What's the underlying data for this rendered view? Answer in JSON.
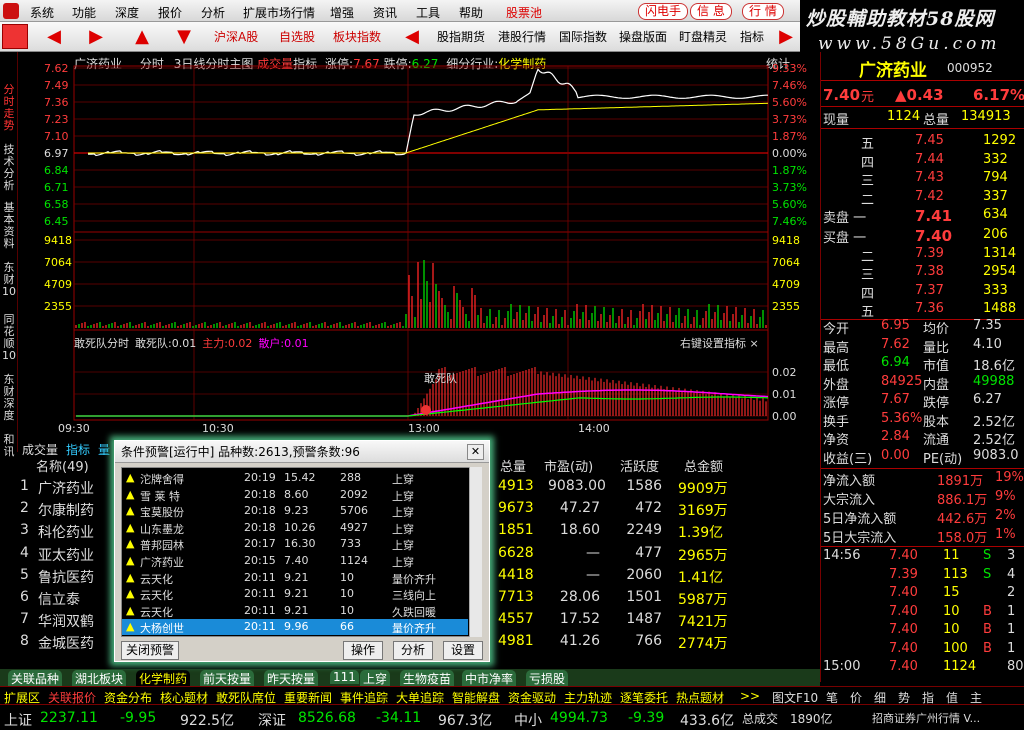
{
  "menu": {
    "items": [
      "系统",
      "功能",
      "深度",
      "报价",
      "分析",
      "扩展市场行情",
      "增强",
      "资讯",
      "工具",
      "帮助",
      "股票池"
    ],
    "pills": [
      "闪电手",
      "信 息",
      "行 情"
    ]
  },
  "brand": {
    "line1": "炒股輔助教材58股网",
    "line2": "www.58Gu.com"
  },
  "toolbar": {
    "buttons": [
      "沪深A股",
      "自选股",
      "板块指数",
      "股指期货",
      "港股行情",
      "国际指数",
      "操盘版面",
      "盯盘精灵",
      "指标"
    ]
  },
  "vtabs": [
    "分时走势",
    "技术分析",
    "基本资料",
    "东财10",
    "同花顺10",
    "东财深度",
    "和讯"
  ],
  "chart": {
    "info": {
      "name": "广济药业",
      "mode": "分时",
      "days": "3日线分时主图",
      "vol_label": "成交量",
      "ind": "指标",
      "zt_label": "涨停:",
      "zt": "7.67",
      "dt_label": "跌停:",
      "dt": "6.27",
      "industry": "细分行业:",
      "industry_val": "化学制药"
    },
    "top_right": "统计",
    "price_ticks": [
      "7.62",
      "7.49",
      "7.36",
      "7.23",
      "7.10",
      "6.97",
      "6.84",
      "6.71",
      "6.58",
      "6.45"
    ],
    "pct_ticks": [
      "9.33%",
      "7.46%",
      "5.60%",
      "3.73%",
      "1.87%",
      "0.00%",
      "1.87%",
      "3.73%",
      "5.60%",
      "7.46%"
    ],
    "vol_ticks": [
      "9418",
      "7064",
      "4709",
      "2355"
    ],
    "vol_ticks_right": [
      "9418",
      "7064",
      "4709",
      "2355"
    ],
    "ind_title": {
      "name": "敢死队分时",
      "name2": "敢死队:",
      "v1": "0.01",
      "zl": "主力:",
      "v2": "0.02",
      "sh": "散户:",
      "v3": "0.01"
    },
    "ind_right": "右键设置指标 ×",
    "ind_ticks": [
      "0.02",
      "0.01",
      "0.00"
    ],
    "ind_annot": "敢死队",
    "times": [
      "09:30",
      "10:30",
      "13:00",
      "14:00"
    ]
  },
  "chart_data": {
    "type": "line",
    "x": [
      "09:30",
      "10:30",
      "13:00",
      "14:00"
    ],
    "ylim": [
      6.45,
      7.62
    ]
  },
  "bottomtabs": [
    "成交量",
    "指标",
    "量"
  ],
  "quote": {
    "name": "广济药业",
    "code": "000952",
    "price": "7.40",
    "price_unit": "元",
    "chg": "▲0.43",
    "pct": "6.17%",
    "now_label": "现量",
    "now": "1124",
    "total_label": "总量",
    "total": "134913",
    "sells": [
      {
        "l": "五",
        "p": "7.45",
        "v": "1292"
      },
      {
        "l": "四",
        "p": "7.44",
        "v": "332"
      },
      {
        "l": "三",
        "p": "7.43",
        "v": "794"
      },
      {
        "l": "二",
        "p": "7.42",
        "v": "337"
      },
      {
        "l": "卖盘 一",
        "p": "7.41",
        "v": "634"
      }
    ],
    "buys": [
      {
        "l": "买盘 一",
        "p": "7.40",
        "v": "206"
      },
      {
        "l": "二",
        "p": "7.39",
        "v": "1314"
      },
      {
        "l": "三",
        "p": "7.38",
        "v": "2954"
      },
      {
        "l": "四",
        "p": "7.37",
        "v": "333"
      },
      {
        "l": "五",
        "p": "7.36",
        "v": "1488"
      }
    ],
    "stats": [
      {
        "a": "今开",
        "av": "6.95",
        "b": "均价",
        "bv": "7.35"
      },
      {
        "a": "最高",
        "av": "7.62",
        "b": "量比",
        "bv": "4.10"
      },
      {
        "a": "最低",
        "av": "6.94",
        "b": "市值",
        "bv": "18.6亿"
      },
      {
        "a": "外盘",
        "av": "84925",
        "b": "内盘",
        "bv": "49988"
      },
      {
        "a": "涨停",
        "av": "7.67",
        "b": "跌停",
        "bv": "6.27"
      },
      {
        "a": "换手",
        "av": "5.36%",
        "b": "股本",
        "bv": "2.52亿"
      },
      {
        "a": "净资",
        "av": "2.84",
        "b": "流通",
        "bv": "2.52亿"
      },
      {
        "a": "收益(三)",
        "av": "0.00",
        "b": "PE(动)",
        "bv": "9083.0"
      }
    ],
    "flows": [
      {
        "l": "净流入额",
        "v": "1891万",
        "p": "19%"
      },
      {
        "l": "大宗流入",
        "v": "886.1万",
        "p": "9%"
      },
      {
        "l": "5日净流入额",
        "v": "442.6万",
        "p": "2%"
      },
      {
        "l": "5日大宗流入",
        "v": "158.0万",
        "p": "1%"
      }
    ],
    "ticks": [
      {
        "t": "14:56",
        "p": "7.40",
        "v": "11",
        "s": "S",
        "n": "3"
      },
      {
        "t": "",
        "p": "7.39",
        "v": "113",
        "s": "S",
        "n": "4"
      },
      {
        "t": "",
        "p": "7.40",
        "v": "15",
        "s": "",
        "n": "2"
      },
      {
        "t": "",
        "p": "7.40",
        "v": "10",
        "s": "B",
        "n": "1"
      },
      {
        "t": "",
        "p": "7.40",
        "v": "10",
        "s": "B",
        "n": "1"
      },
      {
        "t": "",
        "p": "7.40",
        "v": "100",
        "s": "B",
        "n": "1"
      },
      {
        "t": "15:00",
        "p": "7.40",
        "v": "1124",
        "s": "",
        "n": "80"
      }
    ]
  },
  "grid": {
    "headers": [
      "名称(49)",
      "总量",
      "市盈(动)",
      "活跃度",
      "总金额"
    ],
    "rows": [
      {
        "i": "1",
        "n": "广济药业",
        "tv": "4913",
        "pe": "9083.00",
        "act": "1586",
        "amt": "9909万"
      },
      {
        "i": "2",
        "n": "尔康制药",
        "tv": "9673",
        "pe": "47.27",
        "act": "472",
        "amt": "3169万"
      },
      {
        "i": "3",
        "n": "科伦药业",
        "tv": "1851",
        "pe": "18.60",
        "act": "2249",
        "amt": "1.39亿"
      },
      {
        "i": "4",
        "n": "亚太药业",
        "tv": "6628",
        "pe": "—",
        "act": "477",
        "amt": "2965万"
      },
      {
        "i": "5",
        "n": "鲁抗医药",
        "tv": "4418",
        "pe": "—",
        "act": "2060",
        "amt": "1.41亿"
      },
      {
        "i": "6",
        "n": "信立泰",
        "tv": "7713",
        "pe": "28.06",
        "act": "1501",
        "amt": "5987万"
      },
      {
        "i": "7",
        "n": "华润双鹤",
        "tv": "4557",
        "pe": "17.52",
        "act": "1487",
        "amt": "7421万"
      },
      {
        "i": "8",
        "n": "金城医药",
        "tv": "4981",
        "pe": "41.26",
        "act": "766",
        "amt": "2774万"
      }
    ]
  },
  "sectorbar": [
    "关联品种",
    "湖北板块",
    "化学制药",
    "前天按量",
    "昨天按量",
    "111",
    "上穿",
    "生物疫苗",
    "中市净率",
    "亏损股"
  ],
  "funcbar": [
    "扩展区",
    "关联报价",
    "资金分布",
    "核心题材",
    "敢死队席位",
    "重要新闻",
    "事件追踪",
    "大单追踪",
    "智能解盘",
    "资金驱动",
    "主力轨迹",
    "逐笔委托",
    "热点题材",
    ">>",
    "图文F10",
    "笔",
    "价",
    "细",
    "势",
    "指",
    "值",
    "主"
  ],
  "status": {
    "sh_l": "上证",
    "sh": "2237.11",
    "sh_c": "-9.95",
    "sh_a": "922.5亿",
    "sz_l": "深证",
    "sz": "8526.68",
    "sz_c": "-34.11",
    "sz_a": "967.3亿",
    "zx_l": "中小",
    "zx": "4994.73",
    "zx_c": "-9.39",
    "zx_a": "433.6亿",
    "tot_l": "总成交",
    "tot": "1890亿",
    "broker": "招商证券广州行情 V..."
  },
  "dialog": {
    "title": "条件预警[运行中] 品种数:2613,预警条数:96",
    "rows": [
      {
        "n": "沱牌舍得",
        "t": "20:19",
        "p": "15.42",
        "v": "288",
        "s": "上穿"
      },
      {
        "n": "雪 莱 特",
        "t": "20:18",
        "p": "8.60",
        "v": "2092",
        "s": "上穿"
      },
      {
        "n": "宝莫股份",
        "t": "20:18",
        "p": "9.23",
        "v": "5706",
        "s": "上穿"
      },
      {
        "n": "山东墨龙",
        "t": "20:18",
        "p": "10.26",
        "v": "4927",
        "s": "上穿"
      },
      {
        "n": "普邦园林",
        "t": "20:17",
        "p": "16.30",
        "v": "733",
        "s": "上穿"
      },
      {
        "n": "广济药业",
        "t": "20:15",
        "p": "7.40",
        "v": "1124",
        "s": "上穿"
      },
      {
        "n": "云天化",
        "t": "20:11",
        "p": "9.21",
        "v": "10",
        "s": "量价齐升"
      },
      {
        "n": "云天化",
        "t": "20:11",
        "p": "9.21",
        "v": "10",
        "s": "三线向上"
      },
      {
        "n": "云天化",
        "t": "20:11",
        "p": "9.21",
        "v": "10",
        "s": "久跌回暖"
      },
      {
        "n": "大杨创世",
        "t": "20:11",
        "p": "9.96",
        "v": "66",
        "s": "量价齐升"
      }
    ],
    "close_btn": "关闭预警",
    "act1": "操作",
    "act2": "分析",
    "act3": "设置"
  }
}
